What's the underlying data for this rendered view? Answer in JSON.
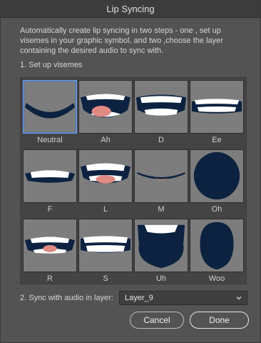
{
  "window": {
    "title": "Lip Syncing"
  },
  "description": "Automatically create lip syncing in two steps - one , set up visemes in your graphic symbol, and two ,choose the layer containing the desired audio to sync with.",
  "step1": {
    "label": "1. Set up visemes"
  },
  "visemes": [
    {
      "label": "Neutral",
      "icon": "mouth-neutral-icon",
      "selected": true
    },
    {
      "label": "Ah",
      "icon": "mouth-ah-icon"
    },
    {
      "label": "D",
      "icon": "mouth-d-icon"
    },
    {
      "label": "Ee",
      "icon": "mouth-ee-icon"
    },
    {
      "label": "F",
      "icon": "mouth-f-icon"
    },
    {
      "label": "L",
      "icon": "mouth-l-icon"
    },
    {
      "label": "M",
      "icon": "mouth-m-icon"
    },
    {
      "label": "Oh",
      "icon": "mouth-oh-icon"
    },
    {
      "label": "R",
      "icon": "mouth-r-icon"
    },
    {
      "label": "S",
      "icon": "mouth-s-icon"
    },
    {
      "label": "Uh",
      "icon": "mouth-uh-icon"
    },
    {
      "label": "Woo",
      "icon": "mouth-woo-icon"
    }
  ],
  "step2": {
    "label": "2. Sync with audio in layer:",
    "selected_layer": "Layer_9"
  },
  "buttons": {
    "cancel": "Cancel",
    "done": "Done"
  },
  "colors": {
    "mouth": "#0c2240",
    "teeth": "#ffffff",
    "tongue": "#e08a84",
    "tongue_m": "#f0a060",
    "thumb_bg": "#7d7d7d",
    "accent": "#6ea3e6"
  }
}
